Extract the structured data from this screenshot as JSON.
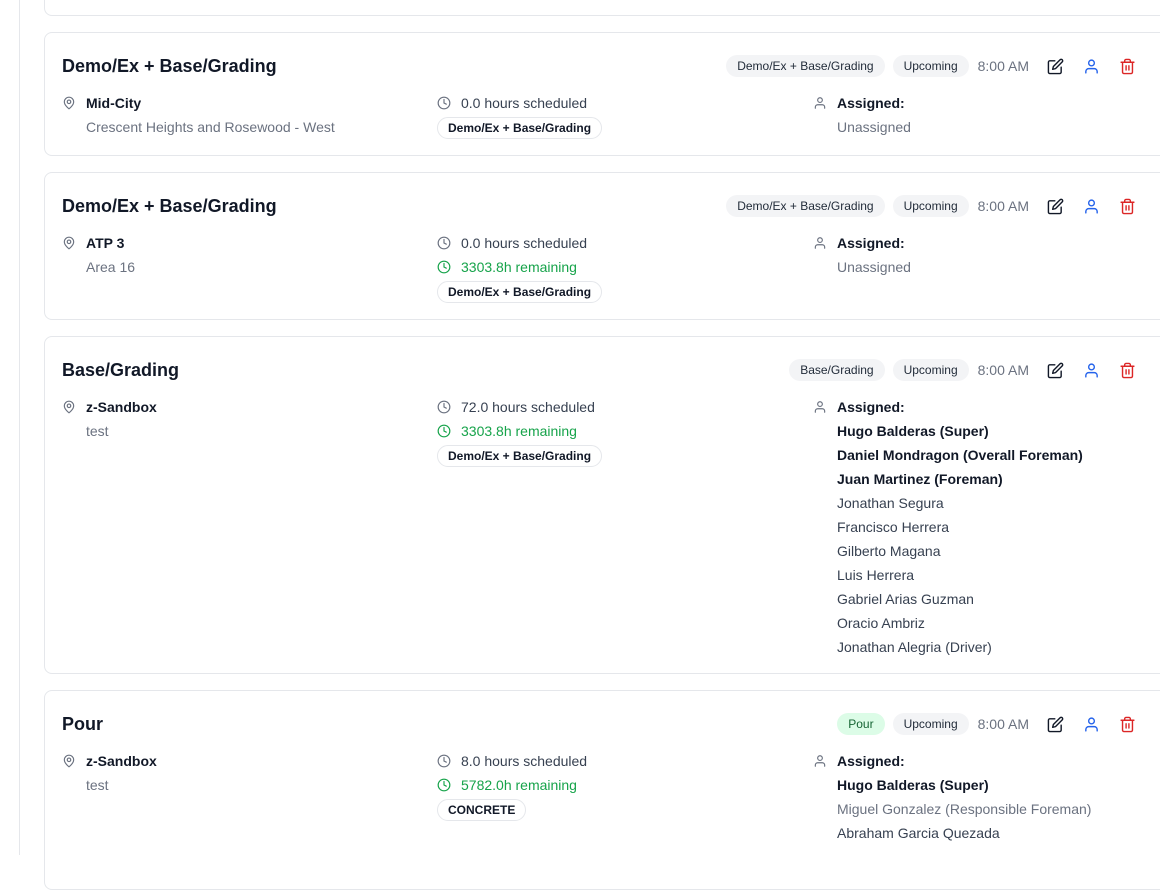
{
  "colors": {
    "accent_blue": "#2563eb",
    "danger_red": "#dc2626",
    "remaining_green": "#16a34a",
    "pour_badge_bg": "#dcfce7"
  },
  "cards": [
    {
      "title": "Demo/Ex + Base/Grading",
      "category_badge": "Demo/Ex + Base/Grading",
      "status": "Upcoming",
      "time": "8:00 AM",
      "location_name": "Mid-City",
      "location_sub": "Crescent Heights and Rosewood - West",
      "hours": "0.0 hours scheduled",
      "remaining": "",
      "tag": "Demo/Ex + Base/Grading",
      "assigned_label": "Assigned:",
      "assignees": [
        {
          "name": "Unassigned",
          "style": "muted"
        }
      ]
    },
    {
      "title": "Demo/Ex + Base/Grading",
      "category_badge": "Demo/Ex + Base/Grading",
      "status": "Upcoming",
      "time": "8:00 AM",
      "location_name": "ATP 3",
      "location_sub": "Area 16",
      "hours": "0.0 hours scheduled",
      "remaining": "3303.8h remaining",
      "tag": "Demo/Ex + Base/Grading",
      "assigned_label": "Assigned:",
      "assignees": [
        {
          "name": "Unassigned",
          "style": "muted"
        }
      ]
    },
    {
      "title": "Base/Grading",
      "category_badge": "Base/Grading",
      "status": "Upcoming",
      "time": "8:00 AM",
      "location_name": "z-Sandbox",
      "location_sub": "test",
      "hours": "72.0 hours scheduled",
      "remaining": "3303.8h remaining",
      "tag": "Demo/Ex + Base/Grading",
      "assigned_label": "Assigned:",
      "assignees": [
        {
          "name": "Hugo Balderas (Super)",
          "style": "bold"
        },
        {
          "name": "Daniel Mondragon (Overall Foreman)",
          "style": "bold"
        },
        {
          "name": "Juan Martinez (Foreman)",
          "style": "bold"
        },
        {
          "name": "Jonathan Segura",
          "style": "normal"
        },
        {
          "name": "Francisco Herrera",
          "style": "normal"
        },
        {
          "name": "Gilberto Magana",
          "style": "normal"
        },
        {
          "name": "Luis Herrera",
          "style": "normal"
        },
        {
          "name": "Gabriel Arias Guzman",
          "style": "normal"
        },
        {
          "name": "Oracio Ambriz",
          "style": "normal"
        },
        {
          "name": "Jonathan Alegria (Driver)",
          "style": "normal"
        }
      ]
    },
    {
      "title": "Pour",
      "category_badge": "Pour",
      "status": "Upcoming",
      "time": "8:00 AM",
      "location_name": "z-Sandbox",
      "location_sub": "test",
      "hours": "8.0 hours scheduled",
      "remaining": "5782.0h remaining",
      "tag": "CONCRETE",
      "assigned_label": "Assigned:",
      "assignees": [
        {
          "name": "Hugo Balderas (Super)",
          "style": "bold"
        },
        {
          "name": "Miguel Gonzalez (Responsible Foreman)",
          "style": "muted"
        },
        {
          "name": "Abraham Garcia Quezada",
          "style": "normal"
        }
      ]
    }
  ]
}
